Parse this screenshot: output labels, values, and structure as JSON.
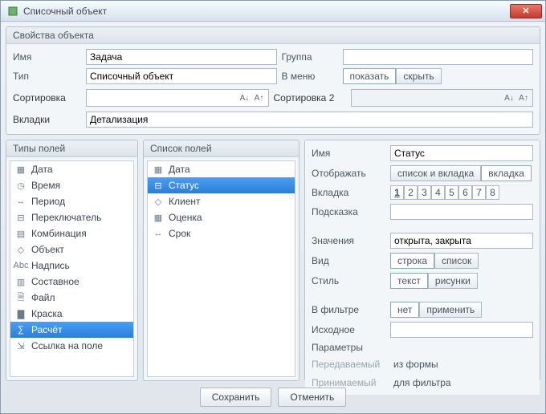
{
  "window": {
    "title": "Списочный объект"
  },
  "props": {
    "panel_title": "Свойства объекта",
    "name_label": "Имя",
    "name_value": "Задача",
    "group_label": "Группа",
    "group_value": "",
    "type_label": "Тип",
    "type_value": "Списочный объект",
    "menu_label": "В меню",
    "menu_show": "показать",
    "menu_hide": "скрыть",
    "sort_label": "Сортировка",
    "sort2_label": "Сортировка 2",
    "tabs_label": "Вкладки",
    "tabs_value": "Детализация"
  },
  "fieldtypes": {
    "title": "Типы полей",
    "items": [
      {
        "label": "Дата",
        "icon": "date-icon"
      },
      {
        "label": "Время",
        "icon": "time-icon"
      },
      {
        "label": "Период",
        "icon": "period-icon"
      },
      {
        "label": "Переключатель",
        "icon": "switch-icon"
      },
      {
        "label": "Комбинация",
        "icon": "combo-icon"
      },
      {
        "label": "Объект",
        "icon": "object-icon"
      },
      {
        "label": "Надпись",
        "icon": "label-icon"
      },
      {
        "label": "Составное",
        "icon": "composite-icon"
      },
      {
        "label": "Файл",
        "icon": "file-icon"
      },
      {
        "label": "Краска",
        "icon": "color-icon"
      },
      {
        "label": "Расчёт",
        "icon": "calc-icon"
      },
      {
        "label": "Ссылка на поле",
        "icon": "link-icon"
      }
    ],
    "selected": 10
  },
  "fieldlist": {
    "title": "Список полей",
    "items": [
      {
        "label": "Дата",
        "icon": "date-icon"
      },
      {
        "label": "Статус",
        "icon": "switch-icon"
      },
      {
        "label": "Клиент",
        "icon": "object-icon"
      },
      {
        "label": "Оценка",
        "icon": "date-icon"
      },
      {
        "label": "Срок",
        "icon": "period-icon"
      }
    ],
    "selected": 1
  },
  "field": {
    "name_label": "Имя",
    "name_value": "Статус",
    "display_label": "Отображать",
    "display_list": "список и вкладка",
    "display_tab": "вкладка",
    "tab_label": "Вкладка",
    "tabs": [
      "1",
      "2",
      "3",
      "4",
      "5",
      "6",
      "7",
      "8"
    ],
    "tab_selected": 0,
    "hint_label": "Подсказка",
    "hint_value": "",
    "values_label": "Значения",
    "values_value": "открыта, закрыта",
    "kind_label": "Вид",
    "kind_string": "строка",
    "kind_list": "список",
    "style_label": "Стиль",
    "style_text": "текст",
    "style_img": "рисунки",
    "filter_label": "В фильтре",
    "filter_no": "нет",
    "filter_apply": "применить",
    "initial_label": "Исходное",
    "initial_value": "",
    "params_label": "Параметры",
    "pass_label": "Передаваемый",
    "pass_value": "из формы",
    "recv_label": "Принимаемый",
    "recv_value": "для фильтра"
  },
  "footer": {
    "save": "Сохранить",
    "cancel": "Отменить"
  },
  "icons": {
    "date-icon": "▦",
    "time-icon": "◷",
    "period-icon": "↔",
    "switch-icon": "⊟",
    "combo-icon": "▤",
    "object-icon": "◇",
    "label-icon": "Abc",
    "composite-icon": "▥",
    "file-icon": "🗎",
    "color-icon": "▇",
    "calc-icon": "∑",
    "link-icon": "⇲",
    "sort-asc-icon": "A↓",
    "sort-desc-icon": "A↑"
  }
}
